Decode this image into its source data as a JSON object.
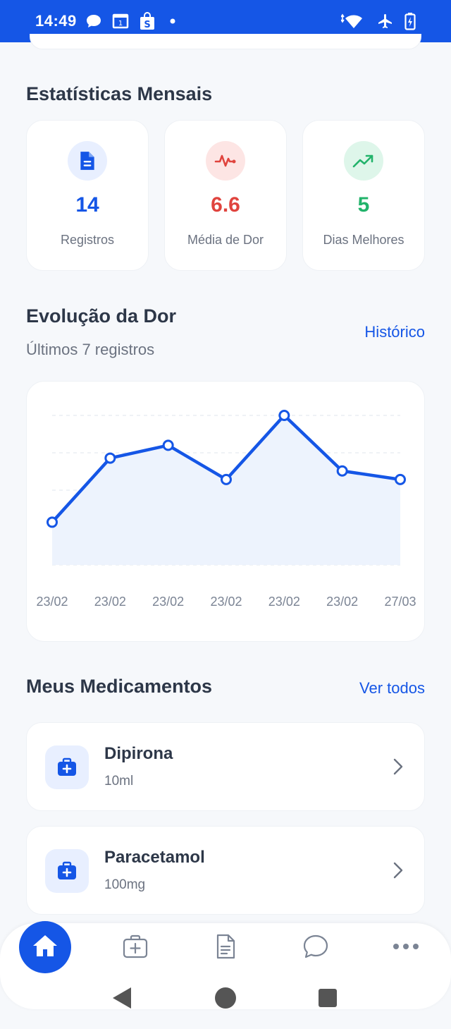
{
  "status_bar": {
    "time": "14:49",
    "left_icons": [
      "chat-bubble-icon",
      "calendar-icon",
      "shopping-bag-icon",
      "dot-icon"
    ],
    "right_icons": [
      "wifi-icon",
      "airplane-icon",
      "battery-icon"
    ]
  },
  "stats": {
    "title": "Estatísticas Mensais",
    "cards": [
      {
        "value": "14",
        "label": "Registros",
        "icon": "document-icon",
        "color": "#1556e6",
        "bg": "#e8efff"
      },
      {
        "value": "6.6",
        "label": "Média de Dor",
        "icon": "heartbeat-icon",
        "color": "#e0443e",
        "bg": "#fde5e4"
      },
      {
        "value": "5",
        "label": "Dias Melhores",
        "icon": "trending-up-icon",
        "color": "#22b36b",
        "bg": "#def6ea"
      }
    ]
  },
  "pain": {
    "title": "Evolução da Dor",
    "subtitle": "Últimos 7 registros",
    "history_link": "Histórico"
  },
  "chart_data": {
    "type": "area",
    "categories": [
      "23/02",
      "23/02",
      "23/02",
      "23/02",
      "23/02",
      "23/02",
      "27/03"
    ],
    "values": [
      4,
      7,
      7.6,
      6,
      9,
      6.4,
      6
    ],
    "ylim": [
      2,
      9
    ],
    "grid": true,
    "color": "#1556e6",
    "fill": "#edf3fd"
  },
  "meds": {
    "title": "Meus Medicamentos",
    "see_all": "Ver todos",
    "items": [
      {
        "name": "Dipirona",
        "dose": "10ml"
      },
      {
        "name": "Paracetamol",
        "dose": "100mg"
      }
    ]
  },
  "bottom_nav": {
    "items": [
      "home-icon",
      "medical-kit-icon",
      "document-icon",
      "chat-icon",
      "more-icon"
    ],
    "active": "home-icon"
  },
  "system_nav": [
    "back-icon",
    "home-circle-icon",
    "recents-icon"
  ]
}
